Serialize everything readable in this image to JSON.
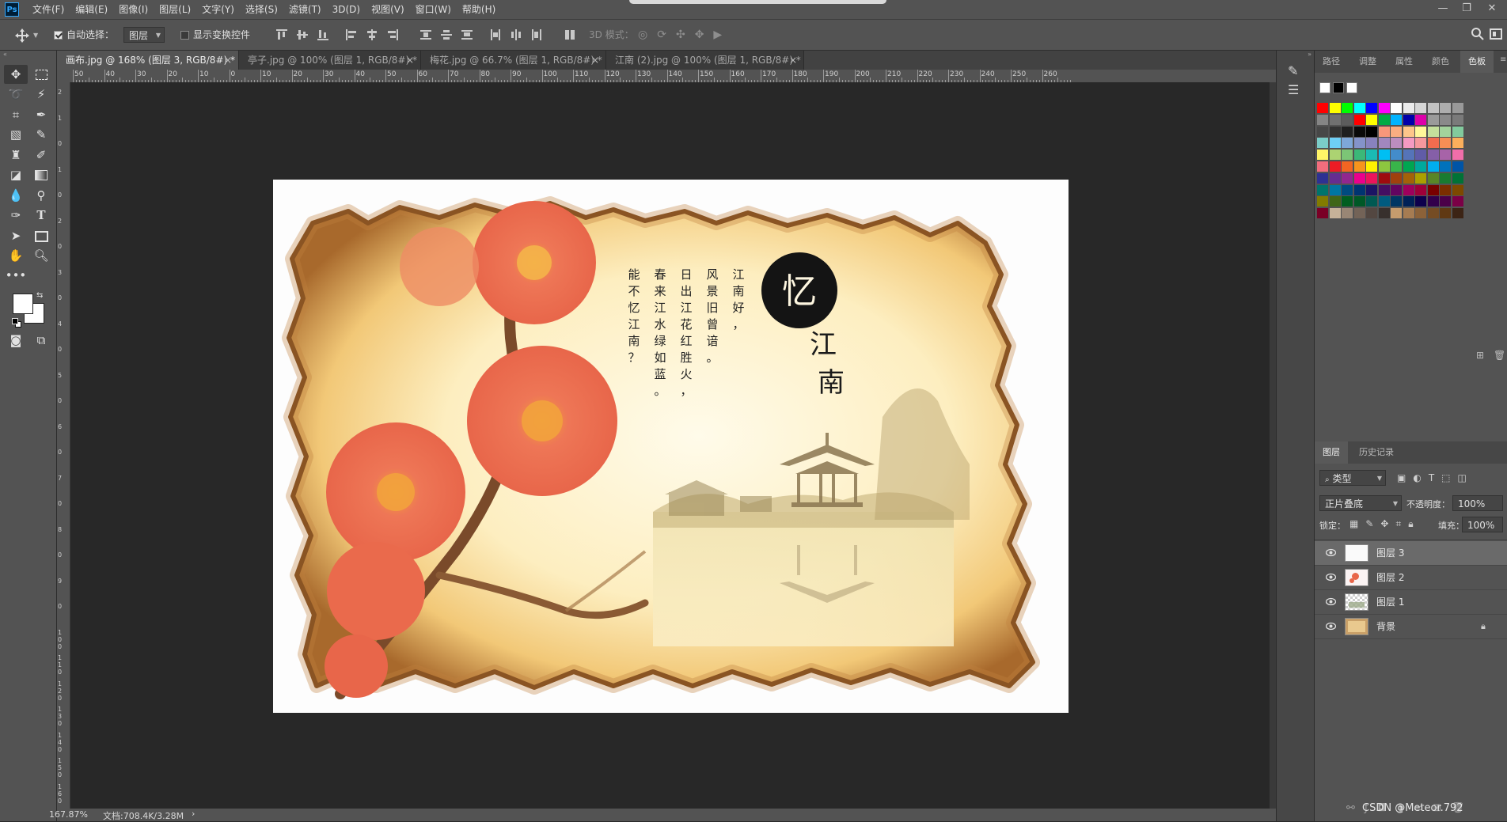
{
  "menubar": {
    "logo": "Ps",
    "items": [
      "文件(F)",
      "编辑(E)",
      "图像(I)",
      "图层(L)",
      "文字(Y)",
      "选择(S)",
      "滤镜(T)",
      "3D(D)",
      "视图(V)",
      "窗口(W)",
      "帮助(H)"
    ],
    "window_controls": [
      "—",
      "❐",
      "✕"
    ]
  },
  "options": {
    "auto_select_label": "自动选择：",
    "auto_select_checked": true,
    "target_value": "图层",
    "show_transform_label": "显示变换控件",
    "show_transform_checked": false,
    "mode_3d_label": "3D 模式："
  },
  "tabs": [
    {
      "label": "画布.jpg @ 168% (图层 3, RGB/8#) *",
      "active": true
    },
    {
      "label": "亭子.jpg @ 100% (图层 1, RGB/8#) *",
      "active": false
    },
    {
      "label": "梅花.jpg @ 66.7% (图层 1, RGB/8#) *",
      "active": false
    },
    {
      "label": "江南 (2).jpg @ 100% (图层 1, RGB/8#) *",
      "active": false
    }
  ],
  "ruler": {
    "h_labels": [
      "50",
      "40",
      "30",
      "20",
      "10",
      "0",
      "10",
      "20",
      "30",
      "40",
      "50",
      "60",
      "70",
      "80",
      "90",
      "100",
      "110",
      "120",
      "130",
      "140",
      "150",
      "160",
      "170",
      "180",
      "190",
      "200",
      "210",
      "220",
      "230",
      "240",
      "250",
      "260"
    ],
    "v_labels": [
      "2",
      "1",
      "0",
      "1",
      "0",
      "2",
      "0",
      "3",
      "0",
      "4",
      "0",
      "5",
      "0",
      "6",
      "0",
      "7",
      "0",
      "8",
      "0",
      "9",
      "0",
      "100",
      "110",
      "120",
      "130",
      "140",
      "150",
      "160"
    ]
  },
  "artwork": {
    "poem_columns": [
      "江南好，",
      "风景旧曾谙。",
      "日出江花红胜火，",
      "春来江水绿如蓝。",
      "能不忆江南？"
    ],
    "seal_char": "忆",
    "title_chars": "江南",
    "colors": {
      "paper": "#fbe9b6",
      "burn": "#7a4a1c",
      "blossom": "#e8664a"
    }
  },
  "status": {
    "zoom": "167.87%",
    "doc": "文档:708.4K/3.28M",
    "arrow": "›"
  },
  "panel_tabs": [
    "路径",
    "调整",
    "属性",
    "颜色",
    "色板"
  ],
  "panel_tabs_active": "色板",
  "swatch_top": [
    "#ffffff",
    "#000000",
    "#ffffff"
  ],
  "swatches": [
    [
      "#ff0000",
      "#ffff00",
      "#00ff00",
      "#00ffff",
      "#0000ff",
      "#ff00ff",
      "#ffffff",
      "#ebebeb",
      "#d6d6d6",
      "#c2c2c2",
      "#adadad",
      "#999999"
    ],
    [
      "#858585",
      "#707070",
      "#5c5c5c",
      "#ff0000",
      "#ffff00",
      "#00aa44",
      "#00b4ff",
      "#0000aa",
      "#dd00aa",
      "#9a9a9a",
      "#8a8a8a",
      "#7a7a7a"
    ],
    [
      "#474747",
      "#333333",
      "#1f1f1f",
      "#0a0a0a",
      "#000000",
      "#f7977a",
      "#f9ad81",
      "#fdc68a",
      "#fff79a",
      "#c4df9b",
      "#a3d39c",
      "#82ca9d"
    ],
    [
      "#7bcdc8",
      "#6ecff6",
      "#7ea7d8",
      "#8493ca",
      "#8882be",
      "#a187be",
      "#bc8dbf",
      "#f49ac2",
      "#f6989d",
      "#f26c4f",
      "#f68e55",
      "#fbaf5c"
    ],
    [
      "#fff467",
      "#acd372",
      "#7cc576",
      "#3bb878",
      "#1abbb4",
      "#00bff3",
      "#438ccb",
      "#5574b9",
      "#605ca8",
      "#855fa8",
      "#a763a8",
      "#f06ea9"
    ],
    [
      "#f26d7d",
      "#ed1c24",
      "#f26522",
      "#f7941d",
      "#fff200",
      "#8dc63f",
      "#39b54a",
      "#00a651",
      "#00a99d",
      "#00aeef",
      "#0072bc",
      "#0054a6"
    ],
    [
      "#2e3192",
      "#662d91",
      "#92278f",
      "#ec008c",
      "#ed145b",
      "#9e0b0f",
      "#a0410d",
      "#a36209",
      "#aba000",
      "#598527",
      "#197b30",
      "#007236"
    ],
    [
      "#00746b",
      "#0076a3",
      "#004b80",
      "#003471",
      "#1b1464",
      "#440e62",
      "#630460",
      "#9e005d",
      "#9e0039",
      "#790000",
      "#7b2e00",
      "#7d4900"
    ],
    [
      "#827b00",
      "#406618",
      "#005e20",
      "#005826",
      "#005952",
      "#005b7f",
      "#003663",
      "#002157",
      "#0d004c",
      "#32004b",
      "#4b0049",
      "#7b0046"
    ],
    [
      "#7a0026",
      "#c7b299",
      "#998675",
      "#736357",
      "#534741",
      "#37302d",
      "#c69c6d",
      "#a67c52",
      "#8c6239",
      "#754c24",
      "#603913",
      "#3c2415"
    ]
  ],
  "layers_panel": {
    "tabs": [
      "图层",
      "历史记录"
    ],
    "kind_label": "类型",
    "blend_mode": "正片叠底",
    "opacity_label": "不透明度：",
    "opacity_value": "100%",
    "lock_label": "锁定：",
    "fill_label": "填充：",
    "fill_value": "100%",
    "layers": [
      {
        "name": "图层 3",
        "selected": true
      },
      {
        "name": "图层 2",
        "selected": false
      },
      {
        "name": "图层 1",
        "selected": false
      },
      {
        "name": "背景",
        "selected": false,
        "locked": true
      }
    ]
  },
  "watermark": "CSDN @Meteor.792"
}
